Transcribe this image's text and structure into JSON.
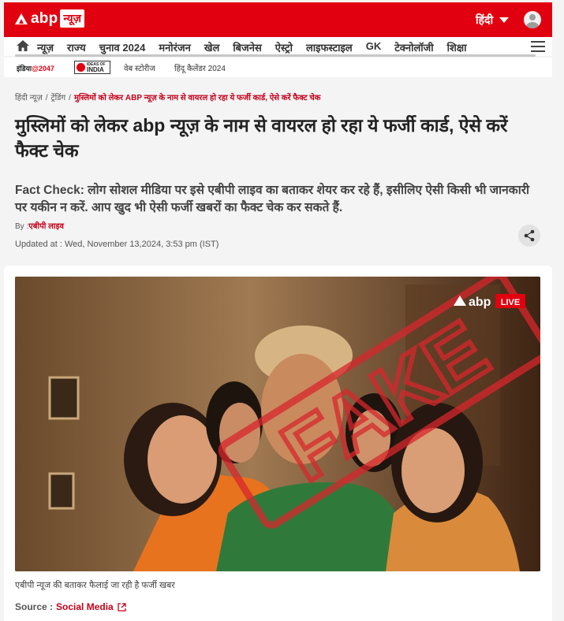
{
  "header": {
    "logo_text": "abp",
    "logo_badge": "न्यूज़",
    "language": "हिंदी",
    "brand_color": "#e1000f"
  },
  "nav": {
    "items": [
      "न्यूज़",
      "राज्य",
      "चुनाव 2024",
      "मनोरंजन",
      "खेल",
      "बिजनेस",
      "ऐस्ट्रो",
      "लाइफस्टाइल",
      "GK",
      "टेक्नोलॉजी",
      "शिक्षा"
    ]
  },
  "subnav": {
    "india2047_prefix": "इंडिया",
    "india2047_suffix": "@2047",
    "ideas_top": "IDEAS OF",
    "ideas_main": "INDIA",
    "web_stories": "वेब स्टोरीज",
    "calendar": "हिंदू कैलेंडर 2024"
  },
  "breadcrumb": {
    "home": "हिंदी न्यूज़",
    "section": "ट्रेंडिंग",
    "current": "मुस्लिमों को लेकर ABP न्यूज़ के नाम से वायरल हो रहा ये फर्जी कार्ड, ऐसे करें फैक्ट चेक"
  },
  "article": {
    "headline": "मुस्लिमों को लेकर abp न्यूज़ के नाम से वायरल हो रहा ये फर्जी कार्ड, ऐसे करें फैक्ट चेक",
    "description": "Fact Check: लोग सोशल मीडिया पर इसे एबीपी लाइव का बताकर शेयर कर रहे हैं, इसीलिए ऐसी किसी भी जानकारी पर यकीन न करें. आप खुद भी ऐसी फर्जी खबरों का फैक्ट चेक कर सकते हैं.",
    "by_label": "By :",
    "author": "एबीपी लाइव",
    "updated": "Updated at : Wed, November 13,2024, 3:53 pm (IST)"
  },
  "image": {
    "watermark_logo": "abp",
    "watermark_live": "LIVE",
    "stamp_text": "FAKE",
    "caption": "एबीपी न्यूज की बताकर फैलाई जा रही है फर्जी खबर"
  },
  "source": {
    "label": "Source :",
    "link": "Social Media"
  }
}
